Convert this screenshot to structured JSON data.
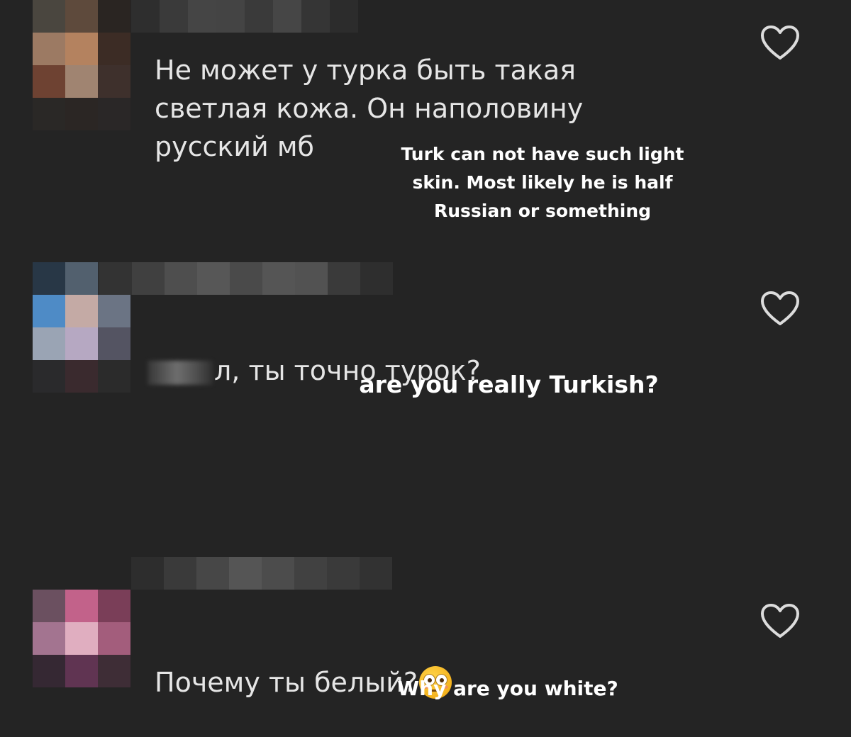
{
  "comments": [
    {
      "text": "Не может у турка быть такая\nсветлая кожа. Он наполовину\nрусский мб",
      "translation": "Turk can not have such light\nskin. Most likely he is half\nRussian or something",
      "avatar_colors": [
        "#4a463f",
        "#5e4a3c",
        "#2a2522",
        "#9c7a63",
        "#b4825f",
        "#3c2c25",
        "#6e4232",
        "#a08471",
        "#3e302c",
        "#2a2826",
        "#2b2624",
        "#2a2727"
      ],
      "username_colors": [
        "#2e2e2e",
        "#3a3a3a",
        "#454545",
        "#444444",
        "#3a3a3a",
        "#464646",
        "#353535",
        "#2c2c2c"
      ]
    },
    {
      "name_suffix": "л",
      "text": ", ты точно турок?",
      "translation": "are you really Turkish?",
      "avatar_colors": [
        "#283746",
        "#52606e",
        "#2b2c2e",
        "#4e8bc6",
        "#c4aaa5",
        "#6b7484",
        "#9aa4b4",
        "#b6a8c2",
        "#545462",
        "#2a2a2c",
        "#3a2a2e",
        "#2b2b2b"
      ],
      "username_colors": [
        "#333333",
        "#404040",
        "#4e4e4e",
        "#575757",
        "#4a4a4a",
        "#555555",
        "#525252",
        "#3a3a3a",
        "#2e2e2e"
      ]
    },
    {
      "text": "Почему ты белый?",
      "emoji": "flushed-face",
      "translation": "Why are you white?",
      "avatar_colors": [
        "#6b5060",
        "#c2628a",
        "#7a3e58",
        "#a37490",
        "#e0aec0",
        "#a35d7c",
        "#352833",
        "#603452",
        "#3e2d36"
      ],
      "username_colors": [
        "#2d2d2d",
        "#3a3a3a",
        "#474747",
        "#555555",
        "#4c4c4c",
        "#414141",
        "#3a3a3a",
        "#323232"
      ]
    }
  ],
  "colors": {
    "background": "#242424",
    "comment_text": "#e6e6e6",
    "translation_text": "#ffffff",
    "heart_outline": "#dcdcdc"
  }
}
